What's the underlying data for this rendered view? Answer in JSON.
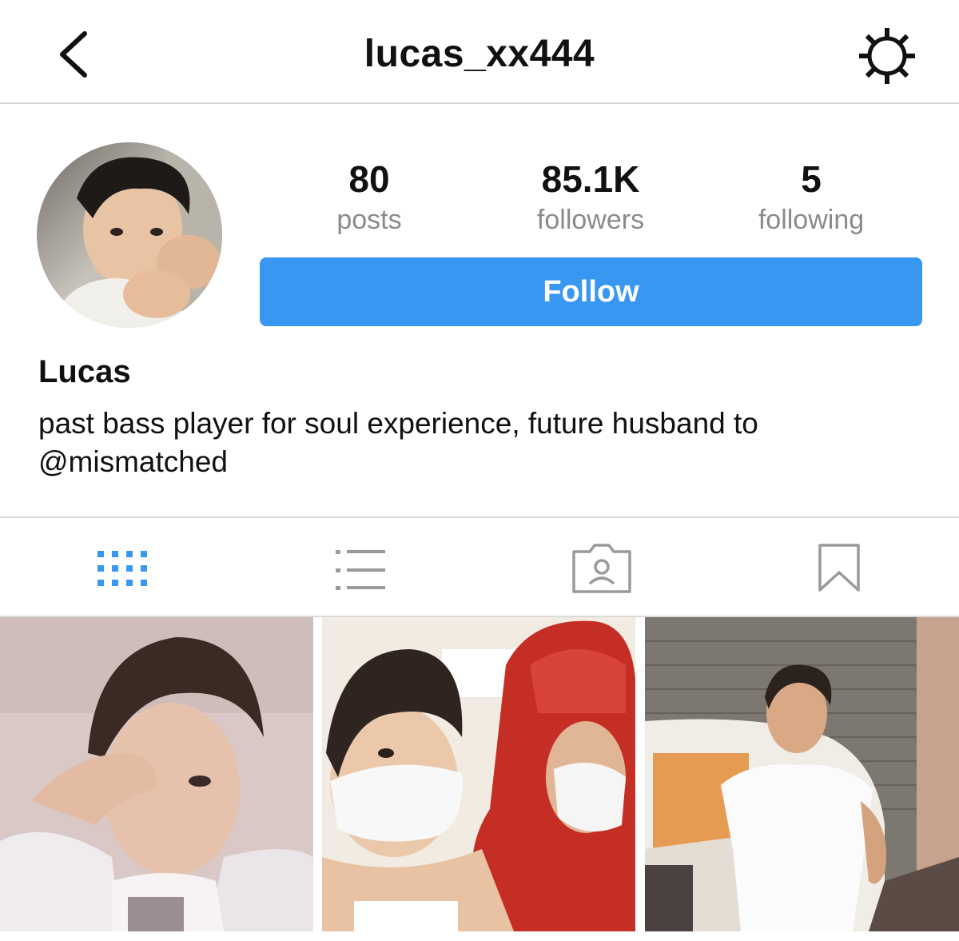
{
  "header": {
    "username": "lucas_xx444",
    "back_icon": "chevron-left-icon",
    "settings_icon": "gear-icon"
  },
  "profile": {
    "stats": [
      {
        "value": "80",
        "label": "posts"
      },
      {
        "value": "85.1K",
        "label": "followers"
      },
      {
        "value": "5",
        "label": "following"
      }
    ],
    "follow_label": "Follow",
    "display_name": "Lucas",
    "bio_line1": "past bass player for soul experience, future husband to",
    "bio_mention": "@mismatched"
  },
  "tabs": [
    {
      "icon": "grid-icon",
      "active": true
    },
    {
      "icon": "list-icon",
      "active": false
    },
    {
      "icon": "tagged-icon",
      "active": false
    },
    {
      "icon": "bookmark-icon",
      "active": false
    }
  ],
  "colors": {
    "accent": "#3897f0",
    "muted_text": "#8a8a8a",
    "divider": "#d9d9d9",
    "icon_inactive": "#9a9a9a"
  }
}
